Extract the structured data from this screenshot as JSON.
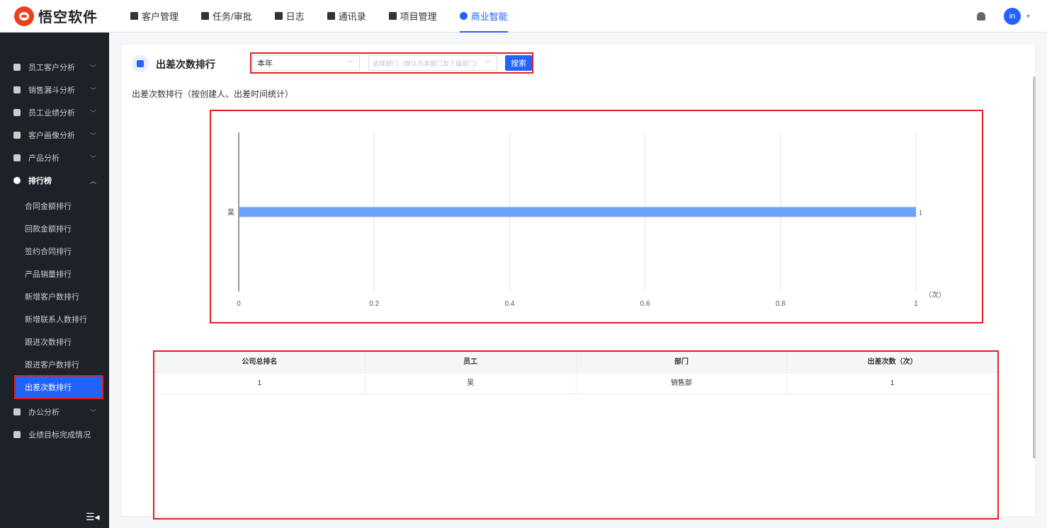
{
  "app": {
    "logo_text": "悟空软件"
  },
  "nav": {
    "items": [
      {
        "label": "客户管理",
        "icon": "customer-icon"
      },
      {
        "label": "任务/审批",
        "icon": "briefcase-icon"
      },
      {
        "label": "日志",
        "icon": "log-icon"
      },
      {
        "label": "通讯录",
        "icon": "contacts-icon"
      },
      {
        "label": "项目管理",
        "icon": "project-icon"
      },
      {
        "label": "商业智能",
        "icon": "bi-icon",
        "active": true
      }
    ],
    "avatar_text": "in",
    "accent_color": "#2362fb"
  },
  "sidebar": {
    "groups": [
      {
        "label": "员工客户分析",
        "icon": "user-icon",
        "expanded": false
      },
      {
        "label": "销售漏斗分析",
        "icon": "funnel-icon",
        "expanded": false
      },
      {
        "label": "员工业绩分析",
        "icon": "bar-chart-icon",
        "expanded": false
      },
      {
        "label": "客户画像分析",
        "icon": "users-icon",
        "expanded": false
      },
      {
        "label": "产品分析",
        "icon": "box-icon",
        "expanded": false
      },
      {
        "label": "排行榜",
        "icon": "trophy-icon",
        "expanded": true
      },
      {
        "label": "办公分析",
        "icon": "briefcase-icon",
        "expanded": false
      },
      {
        "label": "业绩目标完成情况",
        "icon": "target-icon",
        "expanded": false
      }
    ],
    "ranking_items": [
      "合同金额排行",
      "回款金额排行",
      "签约合同排行",
      "产品销量排行",
      "新增客户数排行",
      "新增联系人数排行",
      "跟进次数排行",
      "跟进客户数排行",
      "出差次数排行"
    ],
    "active_item": "出差次数排行",
    "collapse_symbol": "☰◂"
  },
  "page": {
    "title": "出差次数排行",
    "filter": {
      "period_value": "本年",
      "dept_placeholder": "选择部门（默认为本部门及下属部门）",
      "search_label": "搜索"
    },
    "chart_caption": "出差次数排行（按创建人、出差时间统计）"
  },
  "chart_data": {
    "type": "bar",
    "orientation": "horizontal",
    "categories": [
      "吴"
    ],
    "values": [
      1
    ],
    "xlim": [
      0,
      1
    ],
    "x_ticks": [
      "0",
      "0.2",
      "0.4",
      "0.6",
      "0.8",
      "1"
    ],
    "x_unit_label": "（次）",
    "data_labels": [
      "1"
    ],
    "bar_color": "#6ca2f7",
    "grid": true
  },
  "table": {
    "columns": [
      "公司总排名",
      "员工",
      "部门",
      "出差次数（次）"
    ],
    "rows": [
      [
        "1",
        "吴",
        "销售部",
        "1"
      ]
    ]
  }
}
